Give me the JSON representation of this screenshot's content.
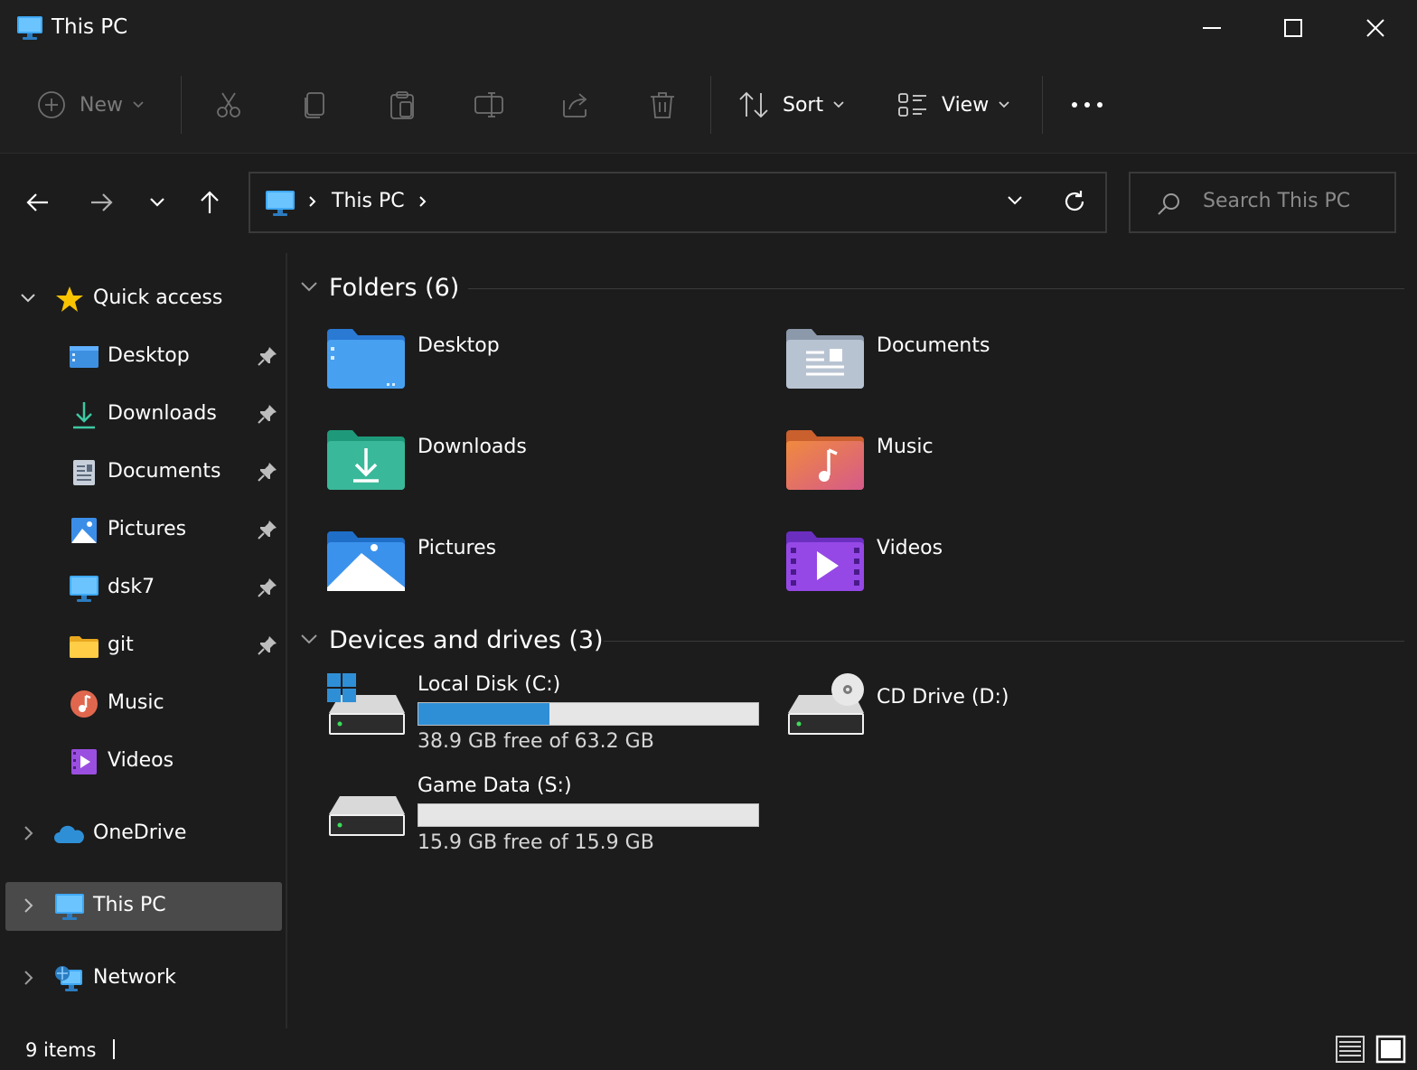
{
  "window": {
    "title": "This PC"
  },
  "toolbar": {
    "new_label": "New",
    "sort_label": "Sort",
    "view_label": "View"
  },
  "address": {
    "location": "This PC"
  },
  "search": {
    "placeholder": "Search This PC"
  },
  "sidebar": {
    "quick_access": "Quick access",
    "items": [
      {
        "label": "Desktop",
        "icon": "desktop-icon"
      },
      {
        "label": "Downloads",
        "icon": "downloads-icon"
      },
      {
        "label": "Documents",
        "icon": "documents-icon"
      },
      {
        "label": "Pictures",
        "icon": "pictures-icon"
      },
      {
        "label": "dsk7",
        "icon": "monitor-icon"
      },
      {
        "label": "git",
        "icon": "folder-icon"
      },
      {
        "label": "Music",
        "icon": "music-icon"
      },
      {
        "label": "Videos",
        "icon": "videos-icon"
      }
    ],
    "onedrive": "OneDrive",
    "this_pc": "This PC",
    "network": "Network"
  },
  "folders": {
    "header": "Folders (6)",
    "items": [
      {
        "name": "Desktop",
        "icon": "desktop-folder-icon"
      },
      {
        "name": "Documents",
        "icon": "documents-folder-icon"
      },
      {
        "name": "Downloads",
        "icon": "downloads-folder-icon"
      },
      {
        "name": "Music",
        "icon": "music-folder-icon"
      },
      {
        "name": "Pictures",
        "icon": "pictures-folder-icon"
      },
      {
        "name": "Videos",
        "icon": "videos-folder-icon"
      }
    ]
  },
  "drives": {
    "header": "Devices and drives (3)",
    "items": [
      {
        "name": "Local Disk (C:)",
        "free": "38.9 GB free of 63.2 GB",
        "used_fraction": 0.385,
        "icon": "windows-drive-icon"
      },
      {
        "name": "CD Drive (D:)",
        "icon": "cd-drive-icon"
      },
      {
        "name": "Game Data (S:)",
        "free": "15.9 GB free of 15.9 GB",
        "used_fraction": 0.0,
        "icon": "hard-drive-icon"
      }
    ],
    "bar_color": "#2f8fd6"
  },
  "status": {
    "items": "9 items"
  }
}
